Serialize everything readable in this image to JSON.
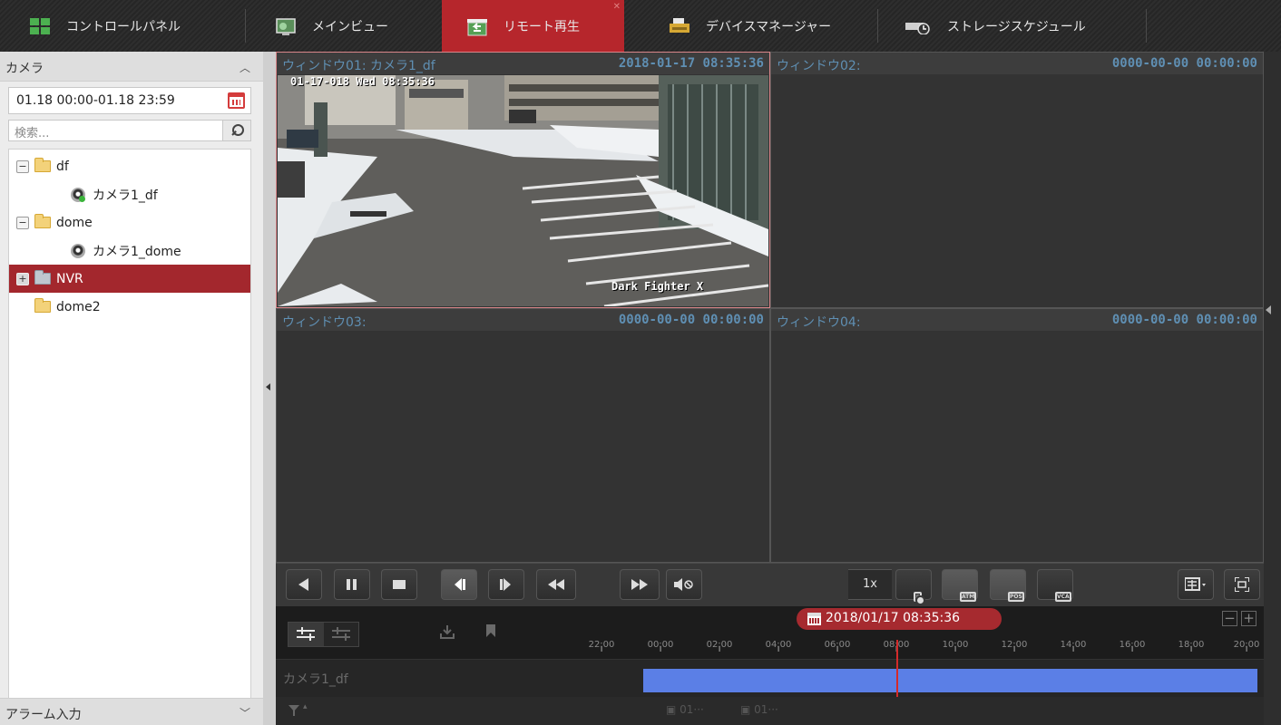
{
  "nav": {
    "tabs": [
      {
        "label": "コントロールパネル",
        "icon": "grid-icon"
      },
      {
        "label": "メインビュー",
        "icon": "monitor-icon"
      },
      {
        "label": "リモート再生",
        "icon": "playback-icon",
        "active": true
      },
      {
        "label": "デバイスマネージャー",
        "icon": "device-icon"
      },
      {
        "label": "ストレージスケジュール",
        "icon": "storage-icon"
      }
    ]
  },
  "left_panel": {
    "camera_header": "カメラ",
    "date_range": "01.18 00:00-01.18 23:59",
    "search_placeholder": "検索...",
    "tree": [
      {
        "label": "df",
        "type": "group",
        "expand": "−"
      },
      {
        "label": "カメラ1_df",
        "type": "camera",
        "recording": true
      },
      {
        "label": "dome",
        "type": "group",
        "expand": "−"
      },
      {
        "label": "カメラ1_dome",
        "type": "camera"
      },
      {
        "label": "NVR",
        "type": "nvr",
        "expand": "+",
        "selected": true
      },
      {
        "label": "dome2",
        "type": "folder"
      }
    ],
    "alarm_header": "アラーム入力"
  },
  "windows": [
    {
      "title": "ウィンドウ01: カメラ1_df",
      "time": "2018-01-17 08:35:36",
      "active": true
    },
    {
      "title": "ウィンドウ02:",
      "time": "0000-00-00 00:00:00"
    },
    {
      "title": "ウィンドウ03:",
      "time": "0000-00-00 00:00:00"
    },
    {
      "title": "ウィンドウ04:",
      "time": "0000-00-00 00:00:00"
    }
  ],
  "video_osd": {
    "top_left": "01-17-018 Wed 08:35:36",
    "bottom_right": "Dark Fighter X"
  },
  "toolbar": {
    "speed": "1x",
    "smart_labels": [
      "ATM",
      "POS",
      "VCA"
    ]
  },
  "timeline": {
    "current_time": "2018/01/17 08:35:36",
    "ticks": [
      "22:00",
      "00:00",
      "02:00",
      "04:00",
      "06:00",
      "08:00",
      "10:00",
      "12:00",
      "14:00",
      "16:00",
      "18:00",
      "20:00"
    ],
    "track_label": "カメラ1_df",
    "file_tags": [
      "01···",
      "01···"
    ]
  },
  "colors": {
    "accent": "#b6262c",
    "record_bar": "#5b7fe6",
    "title_text": "#5f8fb3"
  }
}
